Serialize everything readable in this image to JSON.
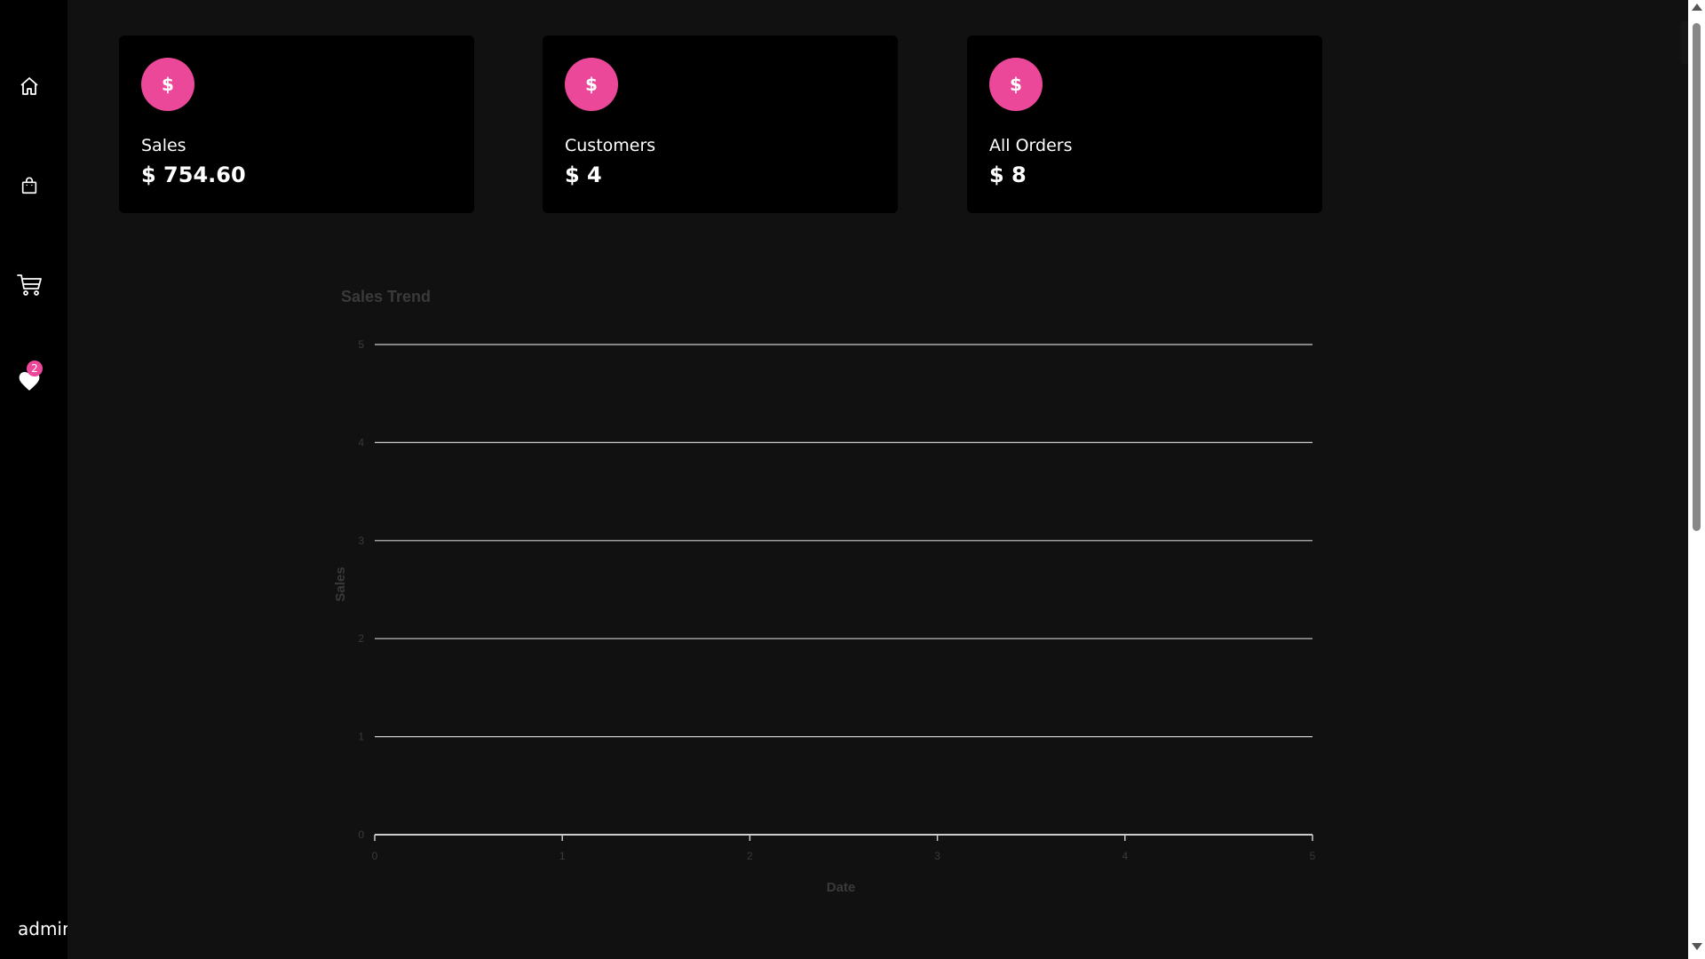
{
  "sidebar": {
    "nav": [
      {
        "icon": "home-icon"
      },
      {
        "icon": "shopping-bag-icon"
      },
      {
        "icon": "cart-icon"
      },
      {
        "icon": "heart-icon",
        "badge": "2"
      }
    ],
    "user_label": "admin"
  },
  "cards": [
    {
      "icon_glyph": "$",
      "label": "Sales",
      "value": "$ 754.60"
    },
    {
      "icon_glyph": "$",
      "label": "Customers",
      "value": "$ 4"
    },
    {
      "icon_glyph": "$",
      "label": "All Orders",
      "value": "$ 8"
    }
  ],
  "header": {
    "menu_icon": "hamburger-menu-icon"
  },
  "colors": {
    "accent": "#ec4899",
    "background": "#111111",
    "sidebar": "#000000",
    "card": "#000000",
    "chart_text": "#3a3a3a",
    "gridline": "#cccccc"
  },
  "chart_data": {
    "type": "line",
    "title": "Sales Trend",
    "xlabel": "Date",
    "ylabel": "Sales",
    "x_ticks": [
      "0",
      "1",
      "2",
      "3",
      "4",
      "5"
    ],
    "y_ticks": [
      "0",
      "1",
      "2",
      "3",
      "4",
      "5"
    ],
    "xlim": [
      0,
      5
    ],
    "ylim": [
      0,
      5
    ],
    "grid": true,
    "series": []
  }
}
